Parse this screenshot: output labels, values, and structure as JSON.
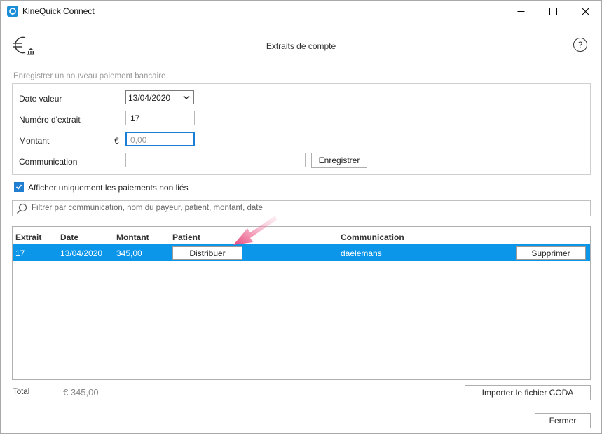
{
  "window": {
    "title": "KineQuick Connect",
    "accent": "#1a8fd8"
  },
  "header": {
    "title": "Extraits de compte",
    "help_label": "?",
    "icon": "euro-bank-icon"
  },
  "form": {
    "legend": "Enregistrer un nouveau paiement bancaire",
    "date_label": "Date valeur",
    "date_value": "13/04/2020",
    "extrait_label": "Numéro d'extrait",
    "extrait_value": "17",
    "montant_label": "Montant",
    "currency": "€",
    "montant_placeholder": "0,00",
    "communication_label": "Communication",
    "communication_value": "",
    "save_label": "Enregistrer"
  },
  "filter": {
    "checkbox_label": "Afficher uniquement les paiements non liés",
    "checked": true,
    "search_placeholder": "Filtrer par communication, nom du payeur, patient, montant, date"
  },
  "table": {
    "headers": {
      "extrait": "Extrait",
      "date": "Date",
      "montant": "Montant",
      "patient": "Patient",
      "communication": "Communication"
    },
    "rows": [
      {
        "extrait": "17",
        "date": "13/04/2020",
        "montant": "345,00",
        "patient_button": "Distribuer",
        "communication": "daelemans",
        "delete_button": "Supprimer"
      }
    ],
    "selected_row_color": "#0b96ea"
  },
  "footer": {
    "total_label": "Total",
    "total_value": "€ 345,00",
    "import_label": "Importer le fichier CODA",
    "close_label": "Fermer"
  },
  "annotation": {
    "arrow_color": "#e8457a"
  }
}
